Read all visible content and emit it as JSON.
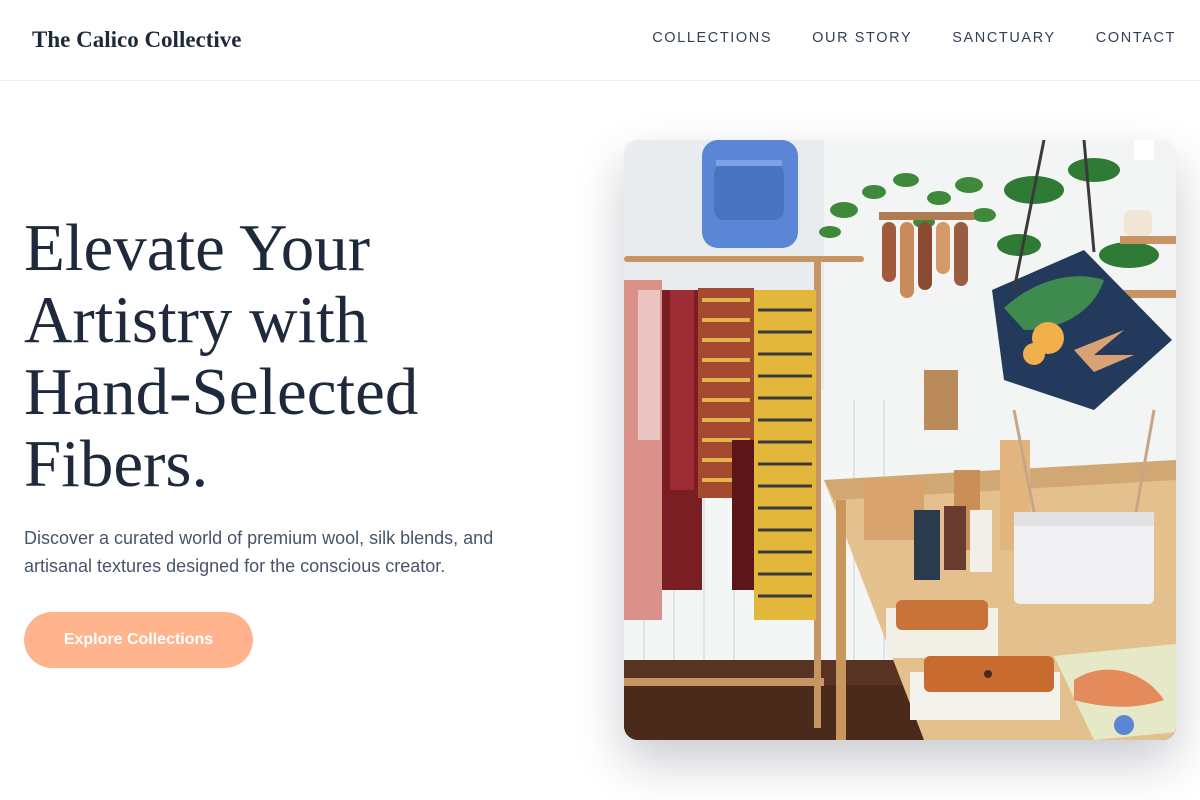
{
  "header": {
    "brand": "The Calico Collective",
    "nav": [
      {
        "label": "COLLECTIONS"
      },
      {
        "label": "OUR STORY"
      },
      {
        "label": "SANCTUARY"
      },
      {
        "label": "CONTACT"
      }
    ]
  },
  "hero": {
    "headline": [
      "Elevate Your",
      "Artistry with",
      "Hand-Selected",
      "Fibers."
    ],
    "subtext": "Discover a curated world of premium wool, silk blends, and artisanal textures designed for the conscious creator.",
    "cta_label": "Explore Collections"
  },
  "colors": {
    "text_primary": "#1e293b",
    "text_secondary": "#475569",
    "accent": "#ffb48e",
    "background": "#ffffff"
  }
}
